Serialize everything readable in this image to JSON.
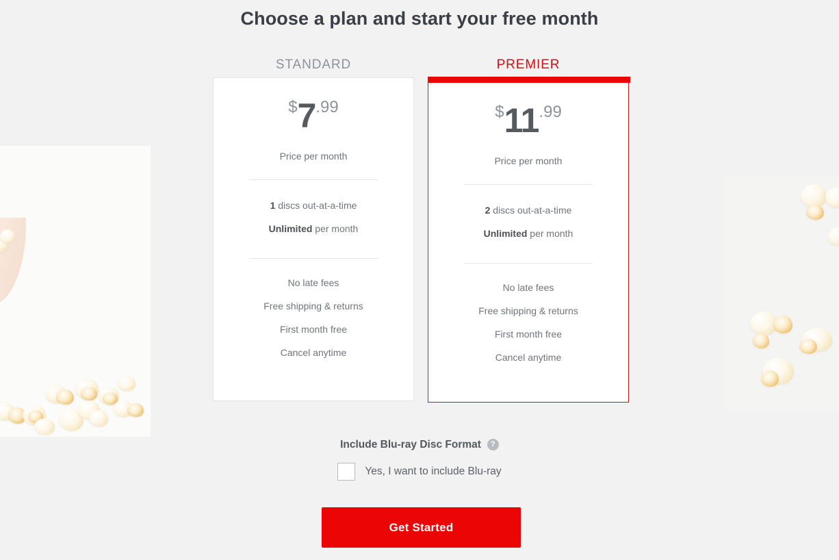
{
  "page": {
    "headline": "Choose a plan and start your free month",
    "background_color": "#f2f2f2"
  },
  "plans": [
    {
      "id": "standard",
      "label": "STANDARD",
      "label_color": "#8d939b",
      "highlighted": false,
      "price": {
        "currency": "$",
        "amount": "7",
        "cents": ".99",
        "caption": "Price per month"
      },
      "features": [
        {
          "emphasis": "1",
          "text": " discs out-at-a-time"
        },
        {
          "emphasis": "Unlimited",
          "text": " per month"
        }
      ],
      "perks": [
        "No late fees",
        "Free shipping & returns",
        "First month free",
        "Cancel anytime"
      ]
    },
    {
      "id": "premier",
      "label": "PREMIER",
      "label_color": "#e50914",
      "highlighted": true,
      "accent_color": "#ec0505",
      "price": {
        "currency": "$",
        "amount": "11",
        "cents": ".99",
        "caption": "Price per month"
      },
      "features": [
        {
          "emphasis": "2",
          "text": " discs out-at-a-time"
        },
        {
          "emphasis": "Unlimited",
          "text": " per month"
        }
      ],
      "perks": [
        "No late fees",
        "Free shipping & returns",
        "First month free",
        "Cancel anytime"
      ]
    }
  ],
  "bluray": {
    "title": "Include Blu-ray Disc Format",
    "help_icon": "question-mark-icon",
    "help_icon_glyph": "?",
    "checkbox_label": "Yes, I want to include Blu-ray",
    "checked": false
  },
  "cta": {
    "label": "Get Started",
    "color": "#ec0505"
  },
  "decor": {
    "left_image": "popcorn-bowl-photo",
    "right_image": "scattered-popcorn-photo"
  }
}
